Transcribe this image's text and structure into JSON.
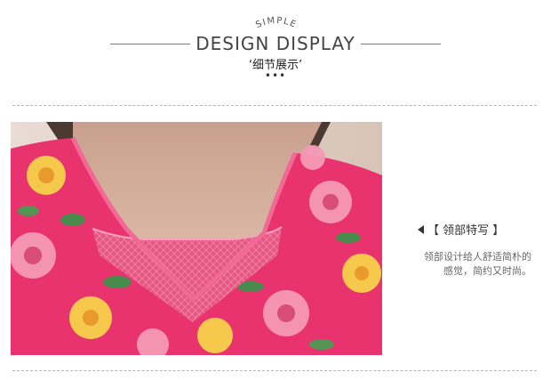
{
  "header": {
    "simple": "SIMPLE",
    "design_display": "DESIGN DISPLAY",
    "subtitle": "‘细节展示’",
    "dots": "•••"
  },
  "feature": {
    "title": "【 领部特写 】",
    "desc_line1": "领部设计给人舒适简朴的",
    "desc_line2": "感觉，简约又时尚。"
  },
  "colors": {
    "fabric_pink": "#e8336f",
    "lace_pink": "#e9507e",
    "skin": "#ddb8a6",
    "text_dark": "#444444",
    "dashed_rule": "#b5b5b5"
  }
}
